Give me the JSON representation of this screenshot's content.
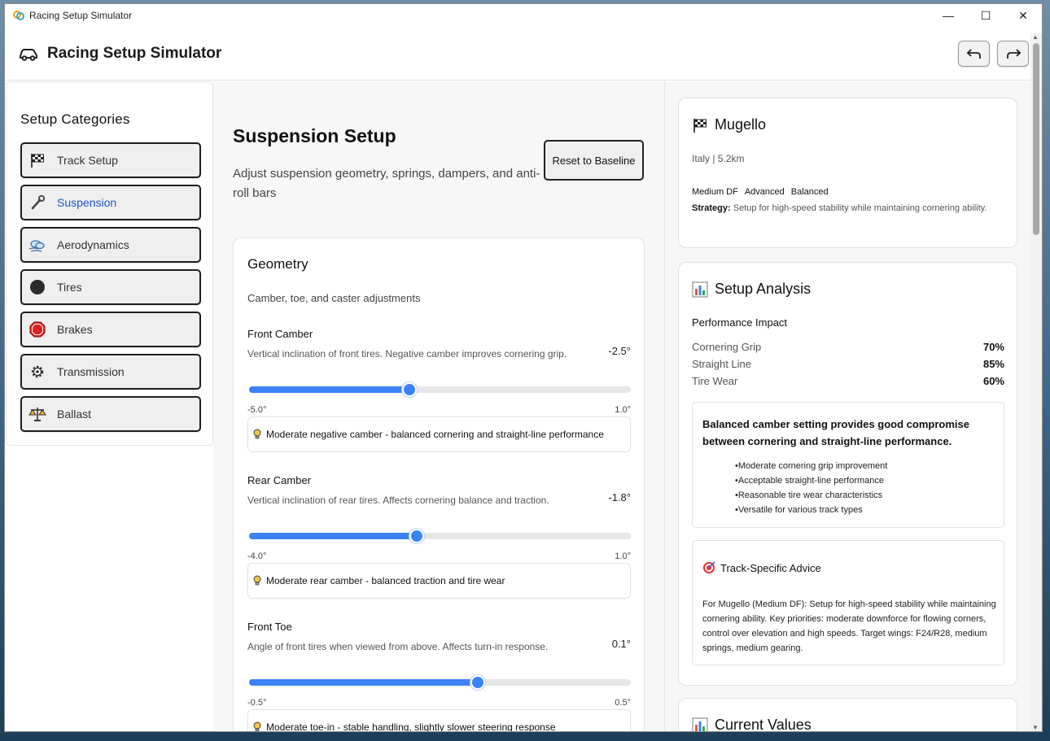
{
  "window": {
    "title": "Racing Setup Simulator"
  },
  "header": {
    "title": "Racing Setup Simulator"
  },
  "sidebar": {
    "title": "Setup Categories",
    "items": [
      {
        "label": "Track Setup",
        "icon": "checkered-flag-icon"
      },
      {
        "label": "Suspension",
        "icon": "wrench-icon",
        "active": true
      },
      {
        "label": "Aerodynamics",
        "icon": "wind-cloud-icon"
      },
      {
        "label": "Tires",
        "icon": "tire-circle-icon"
      },
      {
        "label": "Brakes",
        "icon": "stop-sign-icon"
      },
      {
        "label": "Transmission",
        "icon": "gear-icon"
      },
      {
        "label": "Ballast",
        "icon": "scales-icon"
      }
    ]
  },
  "main": {
    "title": "Suspension Setup",
    "description": "Adjust suspension geometry, springs, dampers, and anti-roll bars",
    "reset_label": "Reset to Baseline",
    "section": {
      "title": "Geometry",
      "subtitle": "Camber, toe, and caster adjustments",
      "params": [
        {
          "name": "Front Camber",
          "description": "Vertical inclination of front tires. Negative camber improves cornering grip.",
          "value": "-2.5°",
          "min": "-5.0°",
          "max": "1.0°",
          "fraction": 0.42,
          "hint": "Moderate negative camber - balanced cornering and straight-line performance"
        },
        {
          "name": "Rear Camber",
          "description": "Vertical inclination of rear tires. Affects cornering balance and traction.",
          "value": "-1.8°",
          "min": "-4.0°",
          "max": "1.0°",
          "fraction": 0.44,
          "hint": "Moderate rear camber - balanced traction and tire wear"
        },
        {
          "name": "Front Toe",
          "description": "Angle of front tires when viewed from above. Affects turn-in response.",
          "value": "0.1°",
          "min": "-0.5°",
          "max": "0.5°",
          "fraction": 0.6,
          "hint": "Moderate toe-in - stable handling, slightly slower steering response"
        }
      ]
    }
  },
  "track": {
    "name": "Mugello",
    "location": "Italy | 5.2km",
    "tags": [
      "Medium DF",
      "Advanced",
      "Balanced"
    ],
    "strategy_label": "Strategy:",
    "strategy_text": "Setup for high-speed stability while maintaining cornering ability."
  },
  "analysis": {
    "title": "Setup Analysis",
    "performance_title": "Performance Impact",
    "metrics": [
      {
        "name": "Cornering Grip",
        "value": "70%"
      },
      {
        "name": "Straight Line",
        "value": "85%"
      },
      {
        "name": "Tire Wear",
        "value": "60%"
      }
    ],
    "summary": "Balanced camber setting provides good compromise between cornering and straight-line performance.",
    "bullets": [
      "•Moderate cornering grip improvement",
      "•Acceptable straight-line performance",
      "•Reasonable tire wear characteristics",
      "•Versatile for various track types"
    ],
    "advice_title": "Track-Specific Advice",
    "advice_text": "For Mugello (Medium DF): Setup for high-speed stability while maintaining cornering ability. Key priorities: moderate downforce for flowing corners, control over elevation and high speeds. Target wings: F24/R28, medium springs, medium gearing."
  },
  "current": {
    "title": "Current Values"
  },
  "colors": {
    "accent": "#3b82f6",
    "active_text": "#2255cc"
  }
}
